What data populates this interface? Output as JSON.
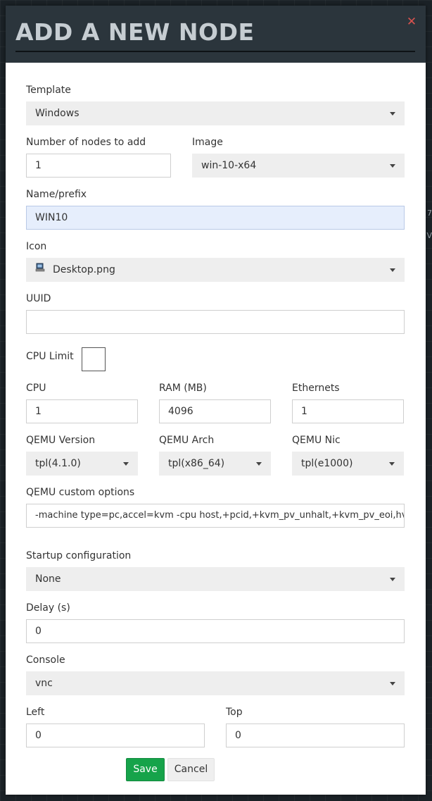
{
  "modal": {
    "title": "ADD A NEW NODE",
    "close_icon": "close-x-icon"
  },
  "fields": {
    "template": {
      "label": "Template",
      "value": "Windows"
    },
    "num_nodes": {
      "label": "Number of nodes to add",
      "value": "1"
    },
    "image": {
      "label": "Image",
      "value": "win-10-x64"
    },
    "name_prefix": {
      "label": "Name/prefix",
      "value": "WIN10"
    },
    "icon": {
      "label": "Icon",
      "value": "Desktop.png",
      "icon": "desktop-computer-icon"
    },
    "uuid": {
      "label": "UUID",
      "value": ""
    },
    "cpu_limit": {
      "label": "CPU Limit",
      "checked": false
    },
    "cpu": {
      "label": "CPU",
      "value": "1"
    },
    "ram": {
      "label": "RAM (MB)",
      "value": "4096"
    },
    "ethernets": {
      "label": "Ethernets",
      "value": "1"
    },
    "qemu_version": {
      "label": "QEMU Version",
      "value": "tpl(4.1.0)"
    },
    "qemu_arch": {
      "label": "QEMU Arch",
      "value": "tpl(x86_64)"
    },
    "qemu_nic": {
      "label": "QEMU Nic",
      "value": "tpl(e1000)"
    },
    "qemu_options": {
      "label": "QEMU custom options",
      "value": "-machine type=pc,accel=kvm -cpu host,+pcid,+kvm_pv_unhalt,+kvm_pv_eoi,hv_sp"
    },
    "startup_config": {
      "label": "Startup configuration",
      "value": "None"
    },
    "delay": {
      "label": "Delay (s)",
      "value": "0"
    },
    "console": {
      "label": "Console",
      "value": "vnc"
    },
    "left": {
      "label": "Left",
      "value": "0"
    },
    "top": {
      "label": "Top",
      "value": "0"
    }
  },
  "buttons": {
    "save": "Save",
    "cancel": "Cancel"
  },
  "background_fragments": [
    "7",
    "V"
  ],
  "colors": {
    "header_bg": "#2b353c",
    "save_bg": "#16a34a",
    "close": "#d9534f",
    "focus_bg": "#e6eefc"
  }
}
